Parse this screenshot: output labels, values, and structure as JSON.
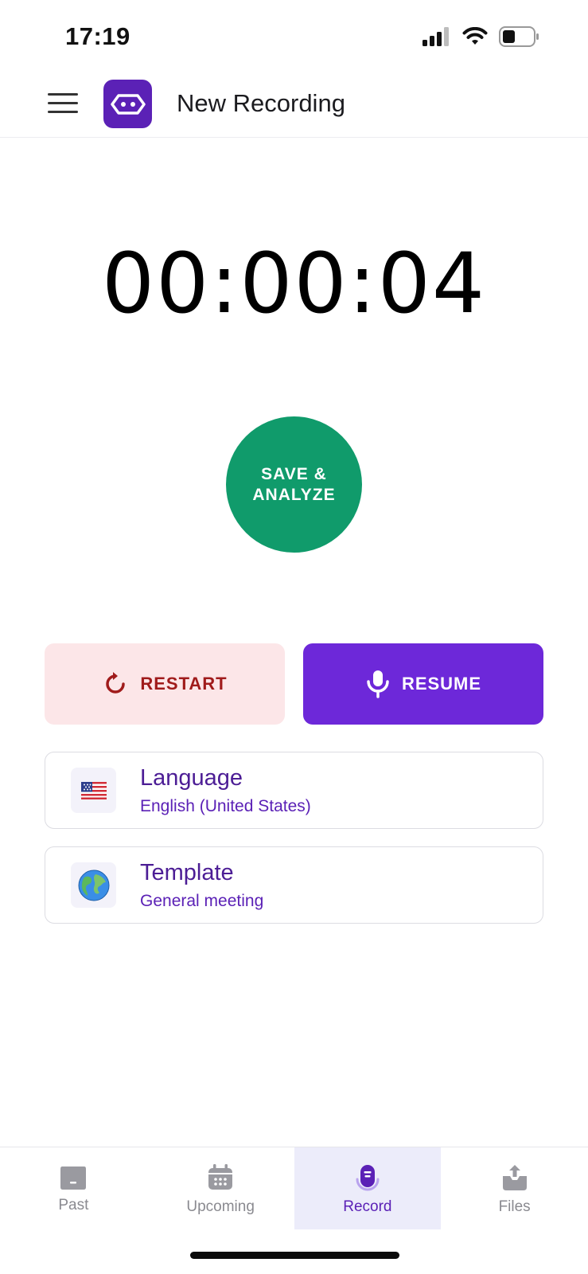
{
  "status_bar": {
    "time": "17:19",
    "icons": [
      "signal-icon",
      "wifi-icon",
      "battery-icon"
    ]
  },
  "header": {
    "title": "New Recording",
    "logo_icon": "robot-face-icon",
    "menu_icon": "hamburger-menu-icon"
  },
  "timer": {
    "display": "00:00:04"
  },
  "actions": {
    "save_label_line1": "SAVE &",
    "save_label_line2": "ANALYZE",
    "restart_label": "RESTART",
    "resume_label": "RESUME"
  },
  "options": {
    "language": {
      "title": "Language",
      "value": "English (United States)",
      "icon": "us-flag-icon"
    },
    "template": {
      "title": "Template",
      "value": "General meeting",
      "icon": "globe-icon"
    }
  },
  "bottom_nav": {
    "items": [
      {
        "label": "Past",
        "icon": "folder-icon"
      },
      {
        "label": "Upcoming",
        "icon": "calendar-icon"
      },
      {
        "label": "Record",
        "icon": "record-mic-icon",
        "active": true
      },
      {
        "label": "Files",
        "icon": "upload-tray-icon"
      }
    ]
  },
  "colors": {
    "brand": "#5b21b6",
    "resume": "#6d28d9",
    "save": "#109b6b",
    "restart_bg": "#fce6e8",
    "restart_text": "#a01b1b"
  }
}
